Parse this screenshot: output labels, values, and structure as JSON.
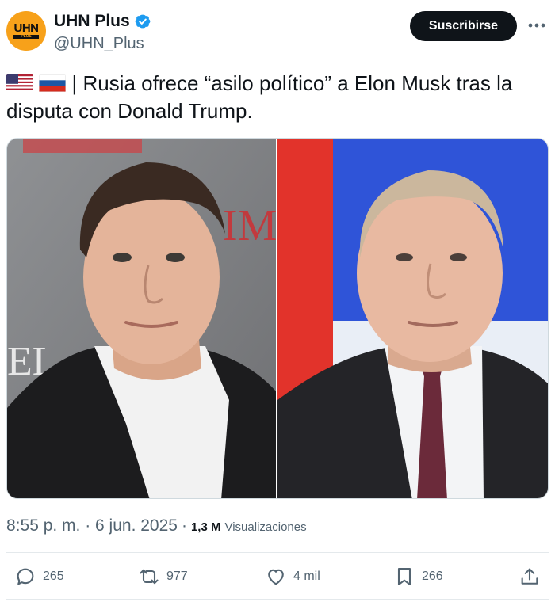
{
  "account": {
    "display_name": "UHN Plus",
    "handle": "@UHN_Plus",
    "avatar_text": "UHN",
    "avatar_subtext": "PLUS",
    "verified": true
  },
  "header": {
    "subscribe_label": "Suscribirse",
    "more_icon": "more-horizontal-icon"
  },
  "tweet": {
    "flags": [
      "united-states-flag",
      "russia-flag"
    ],
    "text": "| Rusia ofrece “asilo político” a Elon Musk tras la disputa con Donald Trump."
  },
  "meta": {
    "timestamp": "8:55 p. m. · 6 jun. 2025",
    "separator": "·",
    "views_count": "1,3 M",
    "views_label": "Visualizaciones"
  },
  "actions": {
    "replies": "265",
    "reposts": "977",
    "likes": "4 mil",
    "bookmarks": "266"
  },
  "colors": {
    "accent": "#1d9bf0",
    "text_primary": "#0f1419",
    "text_secondary": "#536471",
    "avatar_orange": "#f7a11a"
  }
}
